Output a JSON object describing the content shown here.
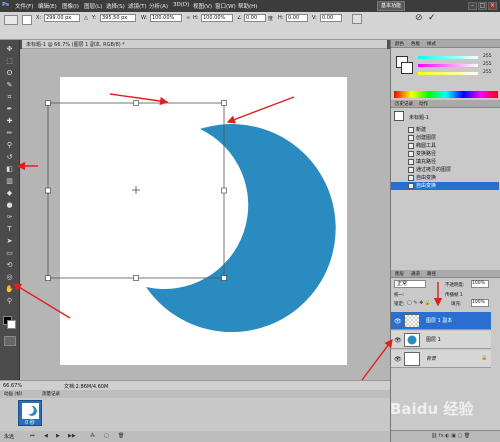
{
  "menu": {
    "logo": "Ps",
    "items": [
      "文件(F)",
      "编辑(E)",
      "图像(I)",
      "图层(L)",
      "选择(S)",
      "滤镜(T)",
      "分析(A)",
      "3D(D)",
      "视图(V)",
      "窗口(W)",
      "帮助(H)"
    ],
    "workspace_button": "基本功能",
    "min": "–",
    "max": "□",
    "close": "×"
  },
  "options_bar": {
    "x_label": "X:",
    "x_value": "299.00 px",
    "y_label": "Y:",
    "y_value": "395.50 px",
    "w_label": "W:",
    "w_value": "100.00%",
    "h_label": "H:",
    "h_value": "100.00%",
    "angle_value": "0.00",
    "angle_unit": "度",
    "hskew_label": "H:",
    "hskew_value": "0.00",
    "vskew_label": "V:",
    "vskew_value": "0.00",
    "cancel_icon": "⊘",
    "commit_icon": "✓"
  },
  "document": {
    "tab_title": "未标题-1 @ 66.7% (图层 1 副本, RGB/8) *",
    "zoom": "66.67%",
    "doc_size": "文档:2.86M/4.60M",
    "moon_color": "#2a8bc0"
  },
  "animation": {
    "tab1": "动画 (帧)",
    "tab2": "测量记录",
    "frame_label": "0 秒",
    "loop_label": "永远"
  },
  "color_panel": {
    "tab1": "颜色",
    "tab2": "色板",
    "tab3": "样式",
    "r_value": "255",
    "g_value": "255",
    "b_value": "255"
  },
  "history_panel": {
    "tab1": "历史记录",
    "tab2": "动作",
    "snapshot": "未标题-1",
    "items": [
      "新建",
      "创建图层",
      "椭圆工具",
      "变换路径",
      "填充路径",
      "通过拷贝的图层",
      "自由变换",
      "自由变换"
    ]
  },
  "layers_panel": {
    "tab1": "图层",
    "tab2": "通道",
    "tab3": "路径",
    "blend_mode": "正常",
    "opacity_label": "不透明度:",
    "opacity_value": "100%",
    "lock_label": "锁定:",
    "fill_label": "填充:",
    "fill_value": "100%",
    "propagate_label": "统一:",
    "propagate_frame": "传播帧 1",
    "layers": [
      {
        "name": "图层 1 副本",
        "selected": true
      },
      {
        "name": "图层 1",
        "selected": false
      },
      {
        "name": "背景",
        "selected": false
      }
    ]
  },
  "watermark": "Baidu 经验"
}
